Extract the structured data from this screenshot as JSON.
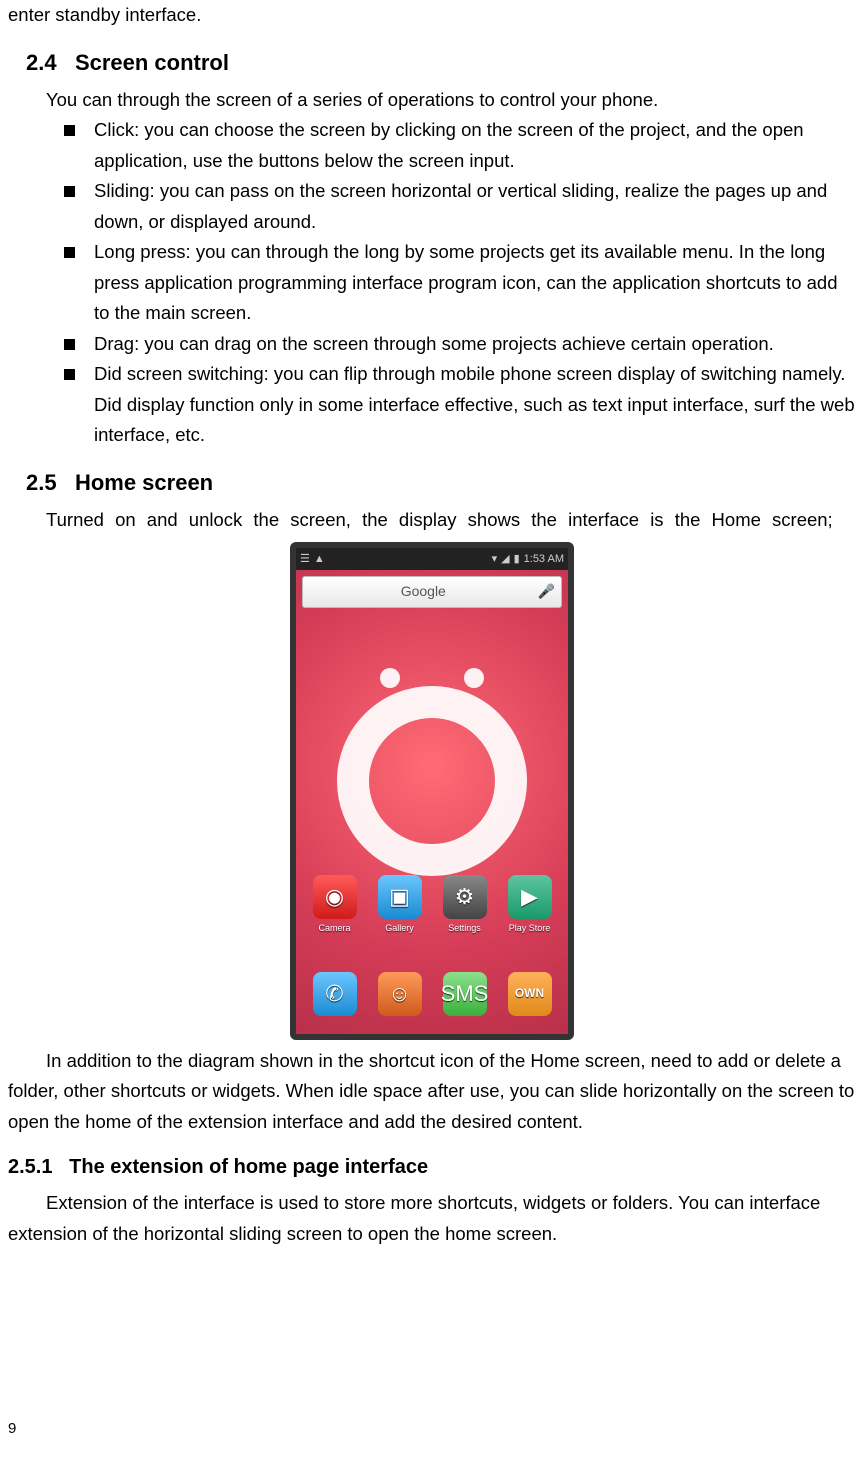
{
  "top_line": "enter standby interface.",
  "s24": {
    "num": "2.4",
    "title": "Screen control",
    "intro": "You can through the screen of a series of operations to control your phone.",
    "items": [
      "Click: you can choose the screen by clicking on the screen of the project, and the open application, use the buttons below the screen input.",
      "Sliding: you can pass on the screen horizontal or vertical sliding, realize the pages up and down, or displayed around.",
      "Long press: you can through the long by some projects get its available menu. In the long press application programming interface program icon, can the application shortcuts to add to the main screen.",
      "Drag: you can drag on the screen through some projects achieve certain operation.",
      "Did screen switching: you can flip through mobile phone screen display of switching namely. Did display function only in some interface effective, such as text input interface, surf the web interface, etc."
    ]
  },
  "s25": {
    "num": "2.5",
    "title": "Home screen",
    "intro": "Turned on and unlock the screen, the display shows the interface is the Home screen;",
    "after_fig": "In addition to the diagram shown in the shortcut icon of the Home screen, need to add or delete a folder, other shortcuts or widgets. When idle space after use, you can slide horizontally on the screen to open the home of the extension interface and add the desired content."
  },
  "s251": {
    "num": "2.5.1",
    "title": "The extension of home page interface",
    "body": "Extension of the interface is used to store more shortcuts, widgets or folders. You can interface extension of the horizontal sliding screen to open the home screen."
  },
  "fig": {
    "status_time": "1:53 AM",
    "search_placeholder": "Google",
    "apps_r1": [
      {
        "label": "Camera",
        "ic": "cam",
        "glyph": "◉"
      },
      {
        "label": "Gallery",
        "ic": "gal",
        "glyph": "▣"
      },
      {
        "label": "Settings",
        "ic": "set",
        "glyph": "⚙"
      },
      {
        "label": "Play Store",
        "ic": "ps",
        "glyph": "▶"
      }
    ],
    "apps_r2": [
      {
        "label": "",
        "ic": "ph",
        "glyph": "✆"
      },
      {
        "label": "",
        "ic": "ppl",
        "glyph": "☺"
      },
      {
        "label": "",
        "ic": "sms",
        "glyph": "SMS"
      },
      {
        "label": "",
        "ic": "own",
        "glyph": "OWN"
      }
    ]
  },
  "page_number": "9"
}
